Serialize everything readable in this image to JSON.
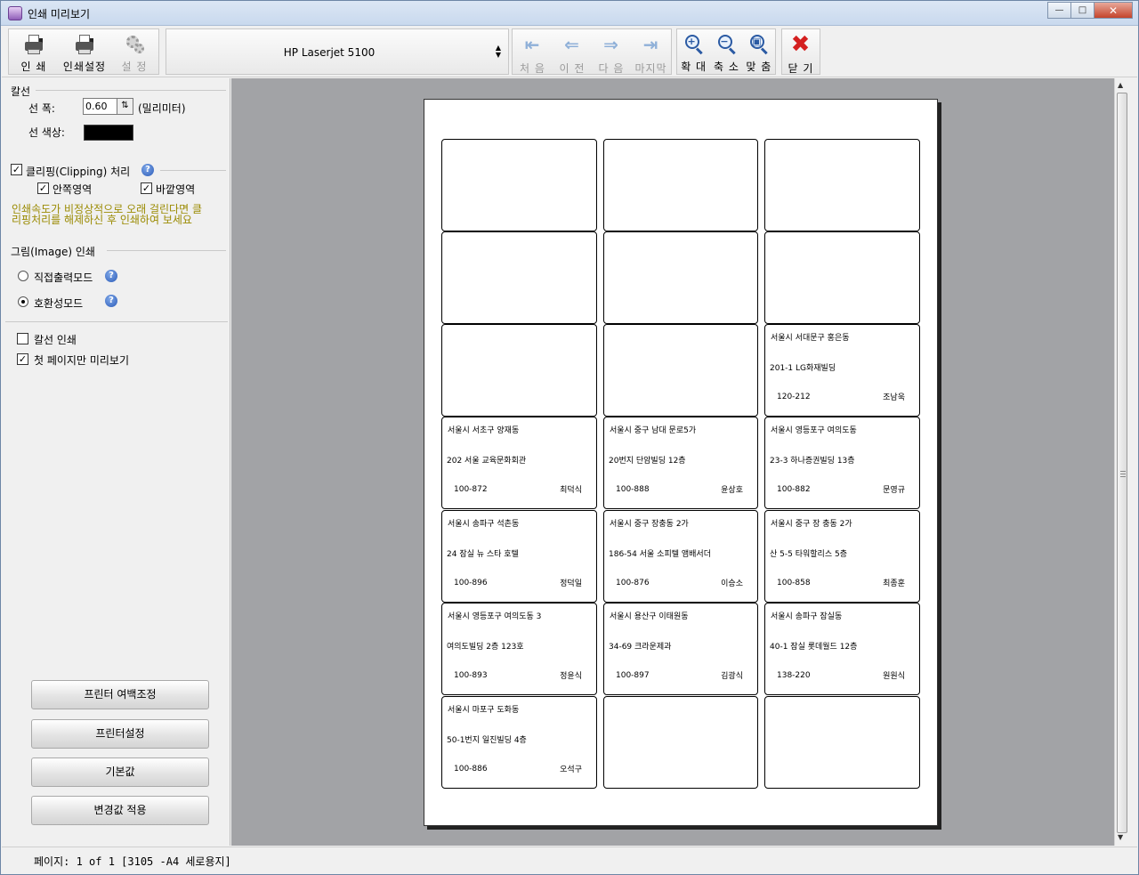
{
  "window": {
    "title": "인쇄 미리보기",
    "minimize": "—",
    "maximize": "□",
    "close": "✕"
  },
  "toolbar": {
    "print": "인 쇄",
    "print_settings": "인쇄설정",
    "settings": "설 정",
    "printer_name": "HP Laserjet 5100",
    "first": "처 음",
    "prev": "이 전",
    "next": "다 음",
    "last": "마지막",
    "zoom_in": "확 대",
    "zoom_out": "축 소",
    "fit": "맞 춤",
    "close": "닫 기"
  },
  "panel": {
    "ruled_line_title": "칼선",
    "line_width_label": "선 폭:",
    "line_width_value": "0.60",
    "line_width_unit": "(밀리미터)",
    "line_color_label": "선 색상:",
    "line_color": "#000000",
    "clipping_label": "클리핑(Clipping) 처리",
    "clipping_checked": true,
    "inner_area_label": "안쪽영역",
    "inner_area_checked": true,
    "outer_area_label": "바깥영역",
    "outer_area_checked": true,
    "warning_line1": "인쇄속도가 비정상적으로 오래 걸린다면 클",
    "warning_line2": "리핑처리를 해제하신 후 인쇄하여 보세요",
    "image_print_title": "그림(Image) 인쇄",
    "direct_mode_label": "직접출력모드",
    "direct_mode_selected": false,
    "compat_mode_label": "호환성모드",
    "compat_mode_selected": true,
    "print_ruled_label": "칼선 인쇄",
    "print_ruled_checked": false,
    "first_page_label": "첫 페이지만 미리보기",
    "first_page_checked": true,
    "margin_button": "프린터 여백조정",
    "printer_setup_button": "프린터설정",
    "default_button": "기본값",
    "apply_button": "변경값 적용"
  },
  "labels": [
    {},
    {},
    {},
    {},
    {},
    {},
    {},
    {},
    {
      "addr1": "서울시 서대문구 홍은동",
      "addr2": "201-1 LG화재빌딩",
      "zip": "120-212",
      "name": "조남욱"
    },
    {
      "addr1": "서울시 서초구 양재동",
      "addr2": "202 서울 교육문화회관",
      "zip": "100-872",
      "name": "최덕식"
    },
    {
      "addr1": "서울시 중구 남대 문로5가",
      "addr2": "20번지 단암빌딩 12층",
      "zip": "100-888",
      "name": "윤상호"
    },
    {
      "addr1": "서울시 영등포구 여의도동",
      "addr2": "23-3 하나증권빌딩 13층",
      "zip": "100-882",
      "name": "문영규"
    },
    {
      "addr1": "서울시 송파구 석촌동",
      "addr2": "24 잠실 뉴 스타 호텔",
      "zip": "100-896",
      "name": "정덕일"
    },
    {
      "addr1": "서울시 중구 장충동 2가",
      "addr2": "186-54 서울 소피텔 앰배서더",
      "zip": "100-876",
      "name": "이승소"
    },
    {
      "addr1": "서울시 중구 장 충동 2가",
      "addr2": "산 5-5 타워할리스 5층",
      "zip": "100-858",
      "name": "최종훈"
    },
    {
      "addr1": "서울시 영등포구 여의도동 3",
      "addr2": "여의도빌딩 2층 123호",
      "zip": "100-893",
      "name": "정윤식"
    },
    {
      "addr1": "서울시 용산구 이태원동",
      "addr2": "34-69 크라운제과",
      "zip": "100-897",
      "name": "김광식"
    },
    {
      "addr1": "서울시 송파구 잠실동",
      "addr2": "40-1 잠실 롯데월드 12층",
      "zip": "138-220",
      "name": "원원식"
    },
    {
      "addr1": "서울시 마포구 도화동",
      "addr2": "50-1번지 일진빌딩 4층",
      "zip": "100-886",
      "name": "오석구"
    },
    {},
    {}
  ],
  "status": {
    "text": "페이지:  1 of  1  [3105 -A4 세로용지]"
  }
}
